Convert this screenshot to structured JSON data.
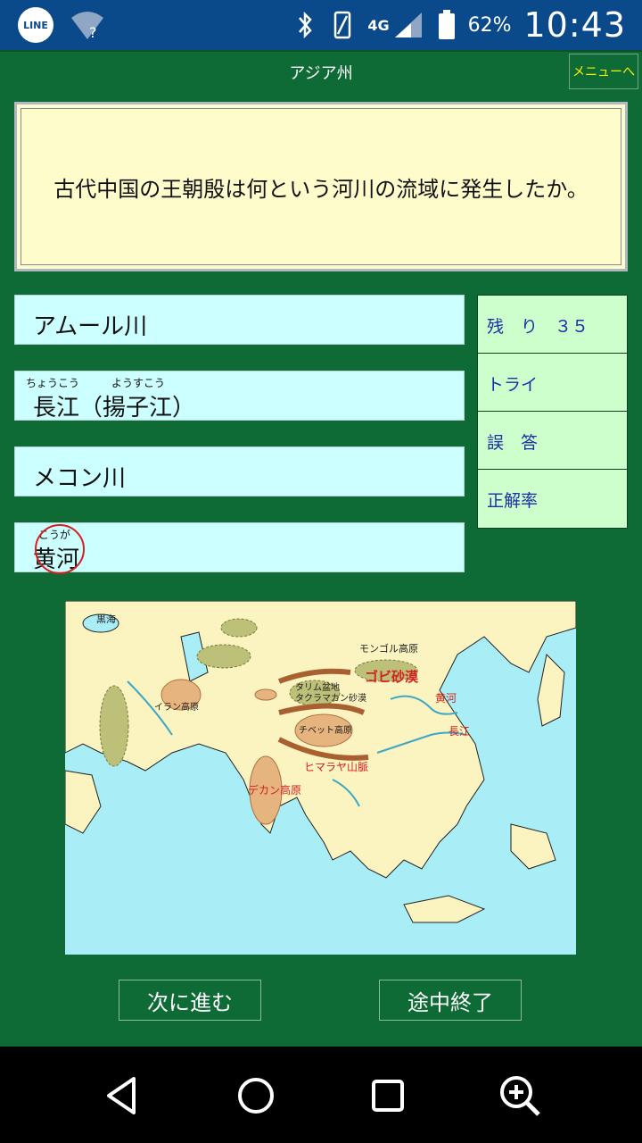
{
  "status": {
    "line_label": "LINE",
    "network": "4G",
    "battery": "62%",
    "time": "10:43"
  },
  "header": {
    "title": "アジア州",
    "menu_button": "メニューへ"
  },
  "question": "古代中国の王朝殷は何という河川の流域に発生したか。",
  "answers": [
    {
      "label": "アムール川"
    },
    {
      "label": "長江（揚子江）",
      "ruby": "ちょうこう",
      "ruby2": "ようすこう"
    },
    {
      "label": "メコン川"
    },
    {
      "label": "黄河",
      "ruby": "こうが"
    }
  ],
  "stats": {
    "remaining": "残　り　３５",
    "try": "トライ",
    "wrong": "誤　答",
    "accuracy": "正解率"
  },
  "map": {
    "labels": {
      "black_sea": "黒海",
      "mongol": "モンゴル高原",
      "gobi": "ゴビ砂漠",
      "tarim": "タリム盆地",
      "taklamakan": "タクラマカン砂漠",
      "iran": "イラン高原",
      "tibet": "チベット高原",
      "himalaya": "ヒマラヤ山脈",
      "deccan": "デカン高原",
      "huanghe": "黄河",
      "changjiang": "長江"
    }
  },
  "buttons": {
    "next": "次に進む",
    "quit": "途中終了"
  },
  "colors": {
    "background": "#0e6b35",
    "question_bg": "#fffccb",
    "answer_bg": "#ccffff",
    "stats_bg": "#ccffcc",
    "stats_text": "#1c2ea8",
    "menu_text": "#f7f200"
  }
}
